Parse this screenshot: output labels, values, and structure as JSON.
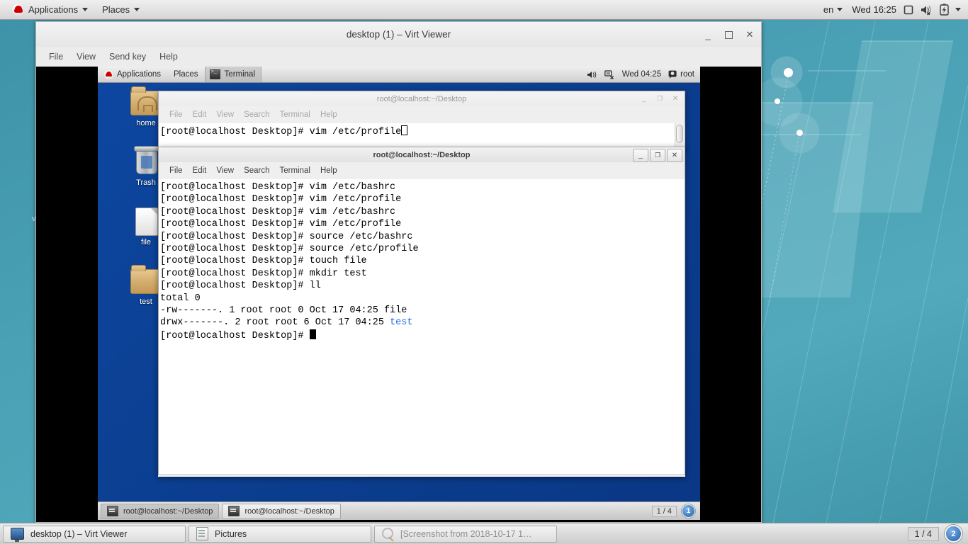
{
  "host_panel": {
    "logo_icon": "redhat-logo-icon",
    "applications_label": "Applications",
    "places_label": "Places",
    "keyboard_label": "en",
    "clock": "Wed 16:25",
    "icons": [
      "display-icon",
      "volume-muted-icon",
      "battery-icon",
      "chevron-down-icon"
    ]
  },
  "virt_viewer": {
    "title": "desktop (1) – Virt Viewer",
    "menus": [
      "File",
      "View",
      "Send key",
      "Help"
    ],
    "window_buttons": {
      "minimize": "_",
      "maximize": "❐",
      "close": "✕"
    }
  },
  "guest_panel": {
    "logo_icon": "redhat-logo-icon",
    "applications_label": "Applications",
    "places_label": "Places",
    "active_task": "Terminal",
    "clock": "Wed 04:25",
    "user": "root",
    "icons": [
      "volume-icon",
      "network-disconnected-icon",
      "user-icon"
    ]
  },
  "desktop_icons": [
    {
      "label": "home",
      "icon": "home-folder-icon"
    },
    {
      "label": "Trash",
      "icon": "trash-icon"
    },
    {
      "label": "file",
      "icon": "document-icon"
    },
    {
      "label": "test",
      "icon": "folder-icon"
    }
  ],
  "terminal_back": {
    "title": "root@localhost:~/Desktop",
    "menus": [
      "File",
      "Edit",
      "View",
      "Search",
      "Terminal",
      "Help"
    ],
    "lines": [
      "[root@localhost Desktop]# vim /etc/profile"
    ],
    "window_buttons": {
      "minimize": "_",
      "maximize": "❐",
      "close": "✕"
    }
  },
  "terminal_front": {
    "title": "root@localhost:~/Desktop",
    "menus": [
      "File",
      "Edit",
      "View",
      "Search",
      "Terminal",
      "Help"
    ],
    "lines": [
      "[root@localhost Desktop]# vim /etc/bashrc",
      "[root@localhost Desktop]# vim /etc/profile",
      "[root@localhost Desktop]# vim /etc/bashrc",
      "[root@localhost Desktop]# vim /etc/profile",
      "[root@localhost Desktop]# source /etc/bashrc",
      "[root@localhost Desktop]# source /etc/profile",
      "[root@localhost Desktop]# touch file",
      "[root@localhost Desktop]# mkdir test",
      "[root@localhost Desktop]# ll",
      "total 0",
      "-rw-------. 1 root root 0 Oct 17 04:25 file"
    ],
    "dir_line_prefix": "drwx-------. 2 root root 6 Oct 17 04:25 ",
    "dir_line_name": "test",
    "prompt": "[root@localhost Desktop]# ",
    "dir_color": "#1f6feb",
    "window_buttons": {
      "minimize": "_",
      "maximize": "❐",
      "close": "✕"
    }
  },
  "guest_taskbar": {
    "tasks": [
      {
        "label": "root@localhost:~/Desktop",
        "active": true
      },
      {
        "label": "root@localhost:~/Desktop",
        "active": false
      }
    ],
    "workspace_text": "1 / 4",
    "workspace_number": "1"
  },
  "host_taskbar": {
    "tasks": [
      {
        "label": "desktop (1) – Virt Viewer",
        "icon": "monitor-icon"
      },
      {
        "label": "Pictures",
        "icon": "file-manager-icon"
      },
      {
        "label": "[Screenshot from 2018-10-17 1…",
        "icon": "image-viewer-icon"
      }
    ],
    "workspace_text": "1 / 4",
    "workspace_number": "2"
  },
  "stray_text": "v",
  "colors": {
    "host_wallpaper": "#4aa0b4",
    "guest_wallpaper": "#0b3f91",
    "terminal_bg": "#ffffff",
    "terminal_fg": "#000000",
    "directory_blue": "#1f6feb",
    "accent_blue": "#2d6ca8"
  }
}
